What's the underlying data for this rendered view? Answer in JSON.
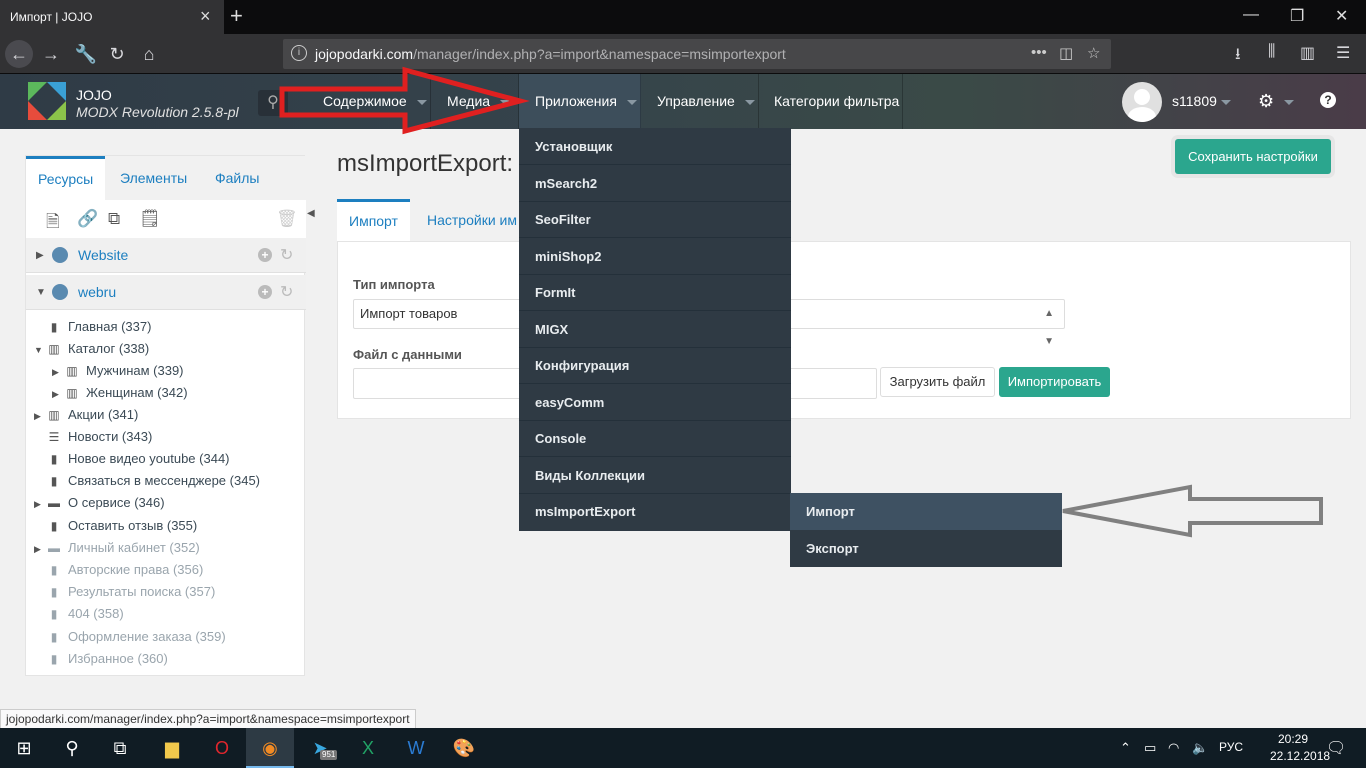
{
  "browser": {
    "tab_title": "Импорт | JOJO",
    "url_domain": "jojopodarki.com",
    "url_path": "/manager/index.php?a=import&namespace=msimportexport",
    "status_url": "jojopodarki.com/manager/index.php?a=import&namespace=msimportexport"
  },
  "header": {
    "site_name": "JOJO",
    "version": "MODX Revolution 2.5.8-pl",
    "menu": [
      {
        "label": "Содержимое"
      },
      {
        "label": "Медиа"
      },
      {
        "label": "Приложения"
      },
      {
        "label": "Управление"
      },
      {
        "label": "Категории фильтра"
      }
    ],
    "username": "s11809"
  },
  "left": {
    "tabs": [
      "Ресурсы",
      "Элементы",
      "Файлы"
    ],
    "contexts": [
      "Website",
      "webru"
    ],
    "tree": [
      {
        "label": "Главная (337)",
        "icon": "page-icon"
      },
      {
        "label": "Каталог (338)",
        "icon": "catalog-icon"
      },
      {
        "label": "Мужчинам (339)",
        "icon": "catalog-icon"
      },
      {
        "label": "Женщинам (342)",
        "icon": "catalog-icon"
      },
      {
        "label": "Акции (341)",
        "icon": "catalog-icon"
      },
      {
        "label": "Новости (343)",
        "icon": "list-icon"
      },
      {
        "label": "Новое видео youtube (344)",
        "icon": "page-icon"
      },
      {
        "label": "Связаться в мессенджере (345)",
        "icon": "page-icon"
      },
      {
        "label": "О сервисе (346)",
        "icon": "folder-icon"
      },
      {
        "label": "Оставить отзыв (355)",
        "icon": "page-icon"
      },
      {
        "label": "Личный кабинет (352)",
        "icon": "folder-icon"
      },
      {
        "label": "Авторские права (356)",
        "icon": "page-icon"
      },
      {
        "label": "Результаты поиска (357)",
        "icon": "page-icon"
      },
      {
        "label": "404 (358)",
        "icon": "page-icon"
      },
      {
        "label": "Оформление заказа (359)",
        "icon": "page-icon"
      },
      {
        "label": "Избранное (360)",
        "icon": "page-icon"
      }
    ]
  },
  "main": {
    "title": "msImportExport:",
    "save_label": "Сохранить настройки",
    "tabs": [
      "Импорт",
      "Настройки им"
    ],
    "import_type_label": "Тип импорта",
    "import_type_value": "Импорт товаров",
    "file_label": "Файл с данными",
    "upload_label": "Загрузить файл",
    "import_label": "Импортировать"
  },
  "app_menu": {
    "items": [
      "Установщик",
      "mSearch2",
      "SeoFilter",
      "miniShop2",
      "FormIt",
      "MIGX",
      "Конфигурация",
      "easyComm",
      "Console",
      "Виды Коллекции",
      "msImportExport"
    ],
    "submenu": [
      "Импорт",
      "Экспорт"
    ]
  },
  "taskbar": {
    "time": "20:29",
    "date": "22.12.2018",
    "lang": "РУС",
    "telegram_badge": "951"
  },
  "colors": {
    "accent": "#2ba68e",
    "link": "#1d7fc0",
    "menu_bg": "#2f3a44",
    "annotation_red": "#e02020",
    "annotation_gray": "#808080"
  }
}
